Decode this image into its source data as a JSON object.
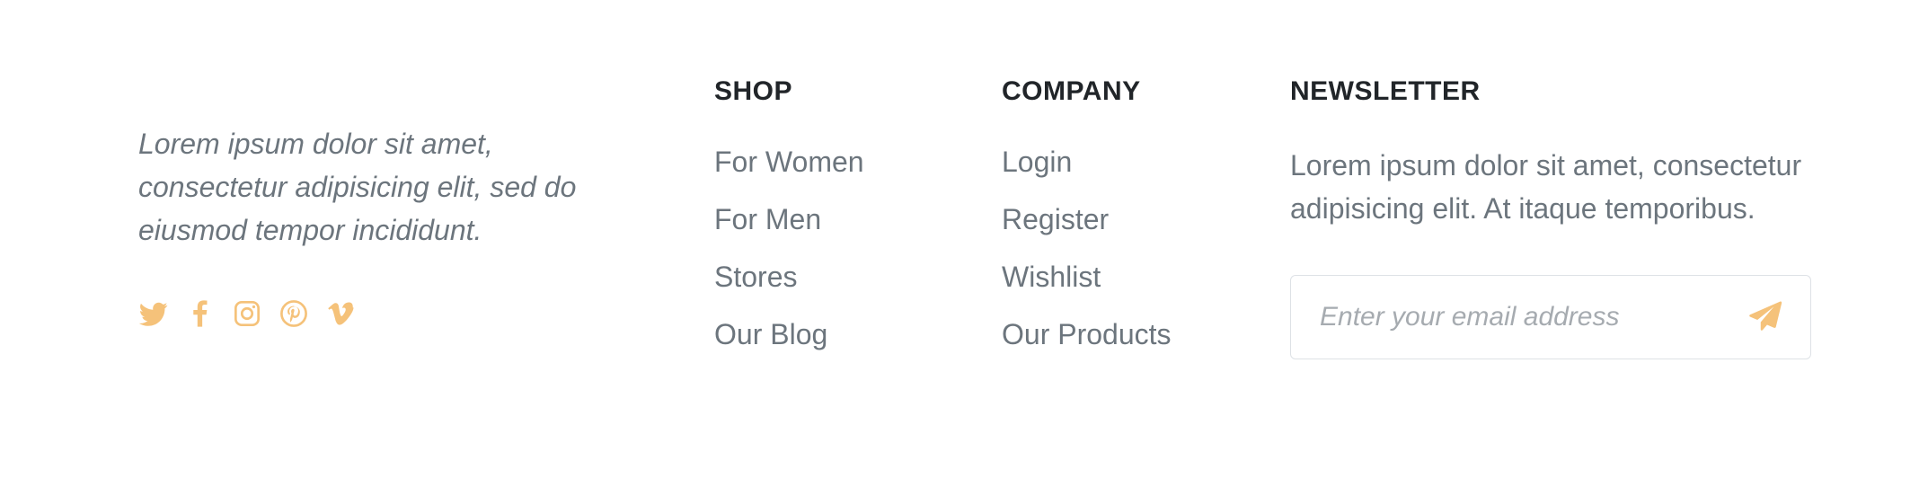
{
  "colors": {
    "accent": "#f5c27a",
    "text_muted": "#6c757d",
    "heading": "#212529",
    "border": "#dee2e6"
  },
  "about": {
    "text": "Lorem ipsum dolor sit amet, consectetur adipisicing elit, sed do eiusmod tempor incididunt."
  },
  "social": [
    "twitter-icon",
    "facebook-icon",
    "instagram-icon",
    "pinterest-icon",
    "vimeo-icon"
  ],
  "shop": {
    "heading": "SHOP",
    "links": [
      "For Women",
      "For Men",
      "Stores",
      "Our Blog"
    ]
  },
  "company": {
    "heading": "COMPANY",
    "links": [
      "Login",
      "Register",
      "Wishlist",
      "Our Products"
    ]
  },
  "newsletter": {
    "heading": "NEWSLETTER",
    "text": "Lorem ipsum dolor sit amet, consectetur adipisicing elit. At itaque temporibus.",
    "placeholder": "Enter your email address",
    "value": "",
    "send_icon": "paper-plane-icon"
  }
}
